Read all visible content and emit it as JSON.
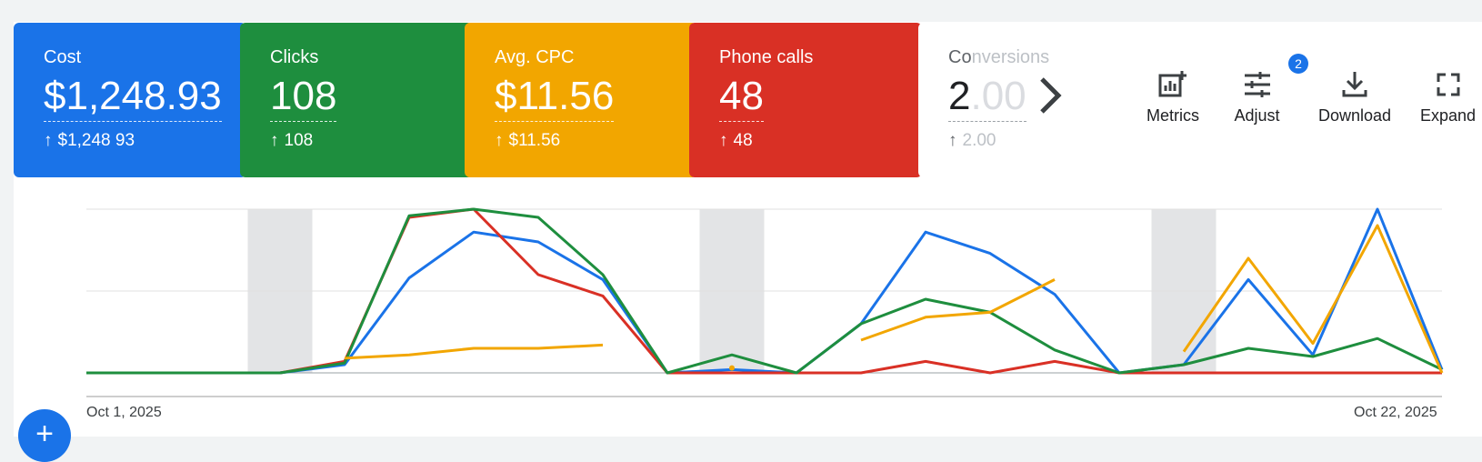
{
  "scorecards": [
    {
      "label": "Cost",
      "value": "$1,248.93",
      "delta": "$1,248 93",
      "color": "#1a73e8"
    },
    {
      "label": "Clicks",
      "value": "108",
      "delta": "108",
      "color": "#1e8e3e"
    },
    {
      "label": "Avg. CPC",
      "value": "$11.56",
      "delta": "$11.56",
      "color": "#f2a600"
    },
    {
      "label": "Phone calls",
      "value": "48",
      "delta": "48",
      "color": "#d93025"
    },
    {
      "label_visible": "Co",
      "label_faded": "nversions",
      "value_visible": "2",
      "value_faded": ".00",
      "delta": "2.00"
    }
  ],
  "delta_arrow": "↑",
  "toolbar": [
    {
      "label": "Metrics",
      "icon": "metrics-icon"
    },
    {
      "label": "Adjust",
      "icon": "adjust-icon",
      "badge": "2"
    },
    {
      "label": "Download",
      "icon": "download-icon"
    },
    {
      "label": "Expand",
      "icon": "expand-icon"
    }
  ],
  "chart_data": {
    "type": "line",
    "x": [
      "Oct 1",
      "Oct 2",
      "Oct 3",
      "Oct 4",
      "Oct 5",
      "Oct 6",
      "Oct 7",
      "Oct 8",
      "Oct 9",
      "Oct 10",
      "Oct 11",
      "Oct 12",
      "Oct 13",
      "Oct 14",
      "Oct 15",
      "Oct 16",
      "Oct 17",
      "Oct 18",
      "Oct 19",
      "Oct 20",
      "Oct 21",
      "Oct 22"
    ],
    "x_tick_labels": [
      "Oct 1, 2025",
      "Oct 22, 2025"
    ],
    "shaded_days": [
      "Oct 4",
      "Oct 11",
      "Oct 18"
    ],
    "ylim": [
      0,
      100
    ],
    "grid": true,
    "series": [
      {
        "color": "#1a73e8",
        "values": [
          0,
          0,
          0,
          0,
          5,
          58,
          86,
          80,
          57,
          0,
          2,
          0,
          30,
          86,
          73,
          48,
          0,
          5,
          57,
          11,
          100,
          2
        ]
      },
      {
        "color": "#d93025",
        "values": [
          0,
          0,
          0,
          0,
          7,
          95,
          100,
          60,
          47,
          0,
          0,
          0,
          0,
          7,
          0,
          7,
          0,
          0,
          0,
          0,
          0,
          0
        ]
      },
      {
        "color": "#1e8e3e",
        "values": [
          0,
          0,
          0,
          0,
          6,
          96,
          100,
          95,
          60,
          0,
          11,
          0,
          30,
          45,
          37,
          14,
          0,
          5,
          15,
          10,
          21,
          2
        ]
      },
      {
        "color": "#f2a600",
        "values": [
          null,
          null,
          null,
          null,
          9,
          11,
          15,
          15,
          17,
          null,
          3,
          null,
          20,
          34,
          37,
          57,
          null,
          13,
          70,
          18,
          90,
          0
        ]
      }
    ]
  },
  "fab_icon": "plus-icon"
}
